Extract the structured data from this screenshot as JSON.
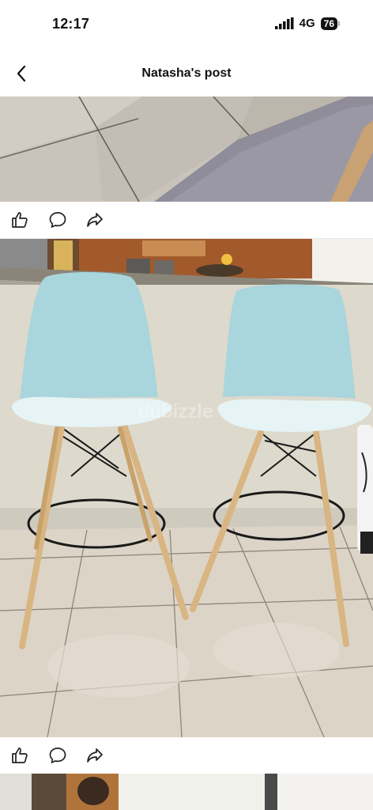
{
  "status_bar": {
    "time": "12:17",
    "network": "4G",
    "battery": "76"
  },
  "header": {
    "title": "Natasha's post"
  },
  "posts": [
    {
      "image_description": "floor-tiles-photo"
    },
    {
      "image_description": "bar-stools-photo",
      "watermark": "dubizzle"
    },
    {
      "image_description": "painting-photo"
    }
  ],
  "actions": {
    "like": "like-icon",
    "comment": "comment-icon",
    "share": "share-icon"
  }
}
